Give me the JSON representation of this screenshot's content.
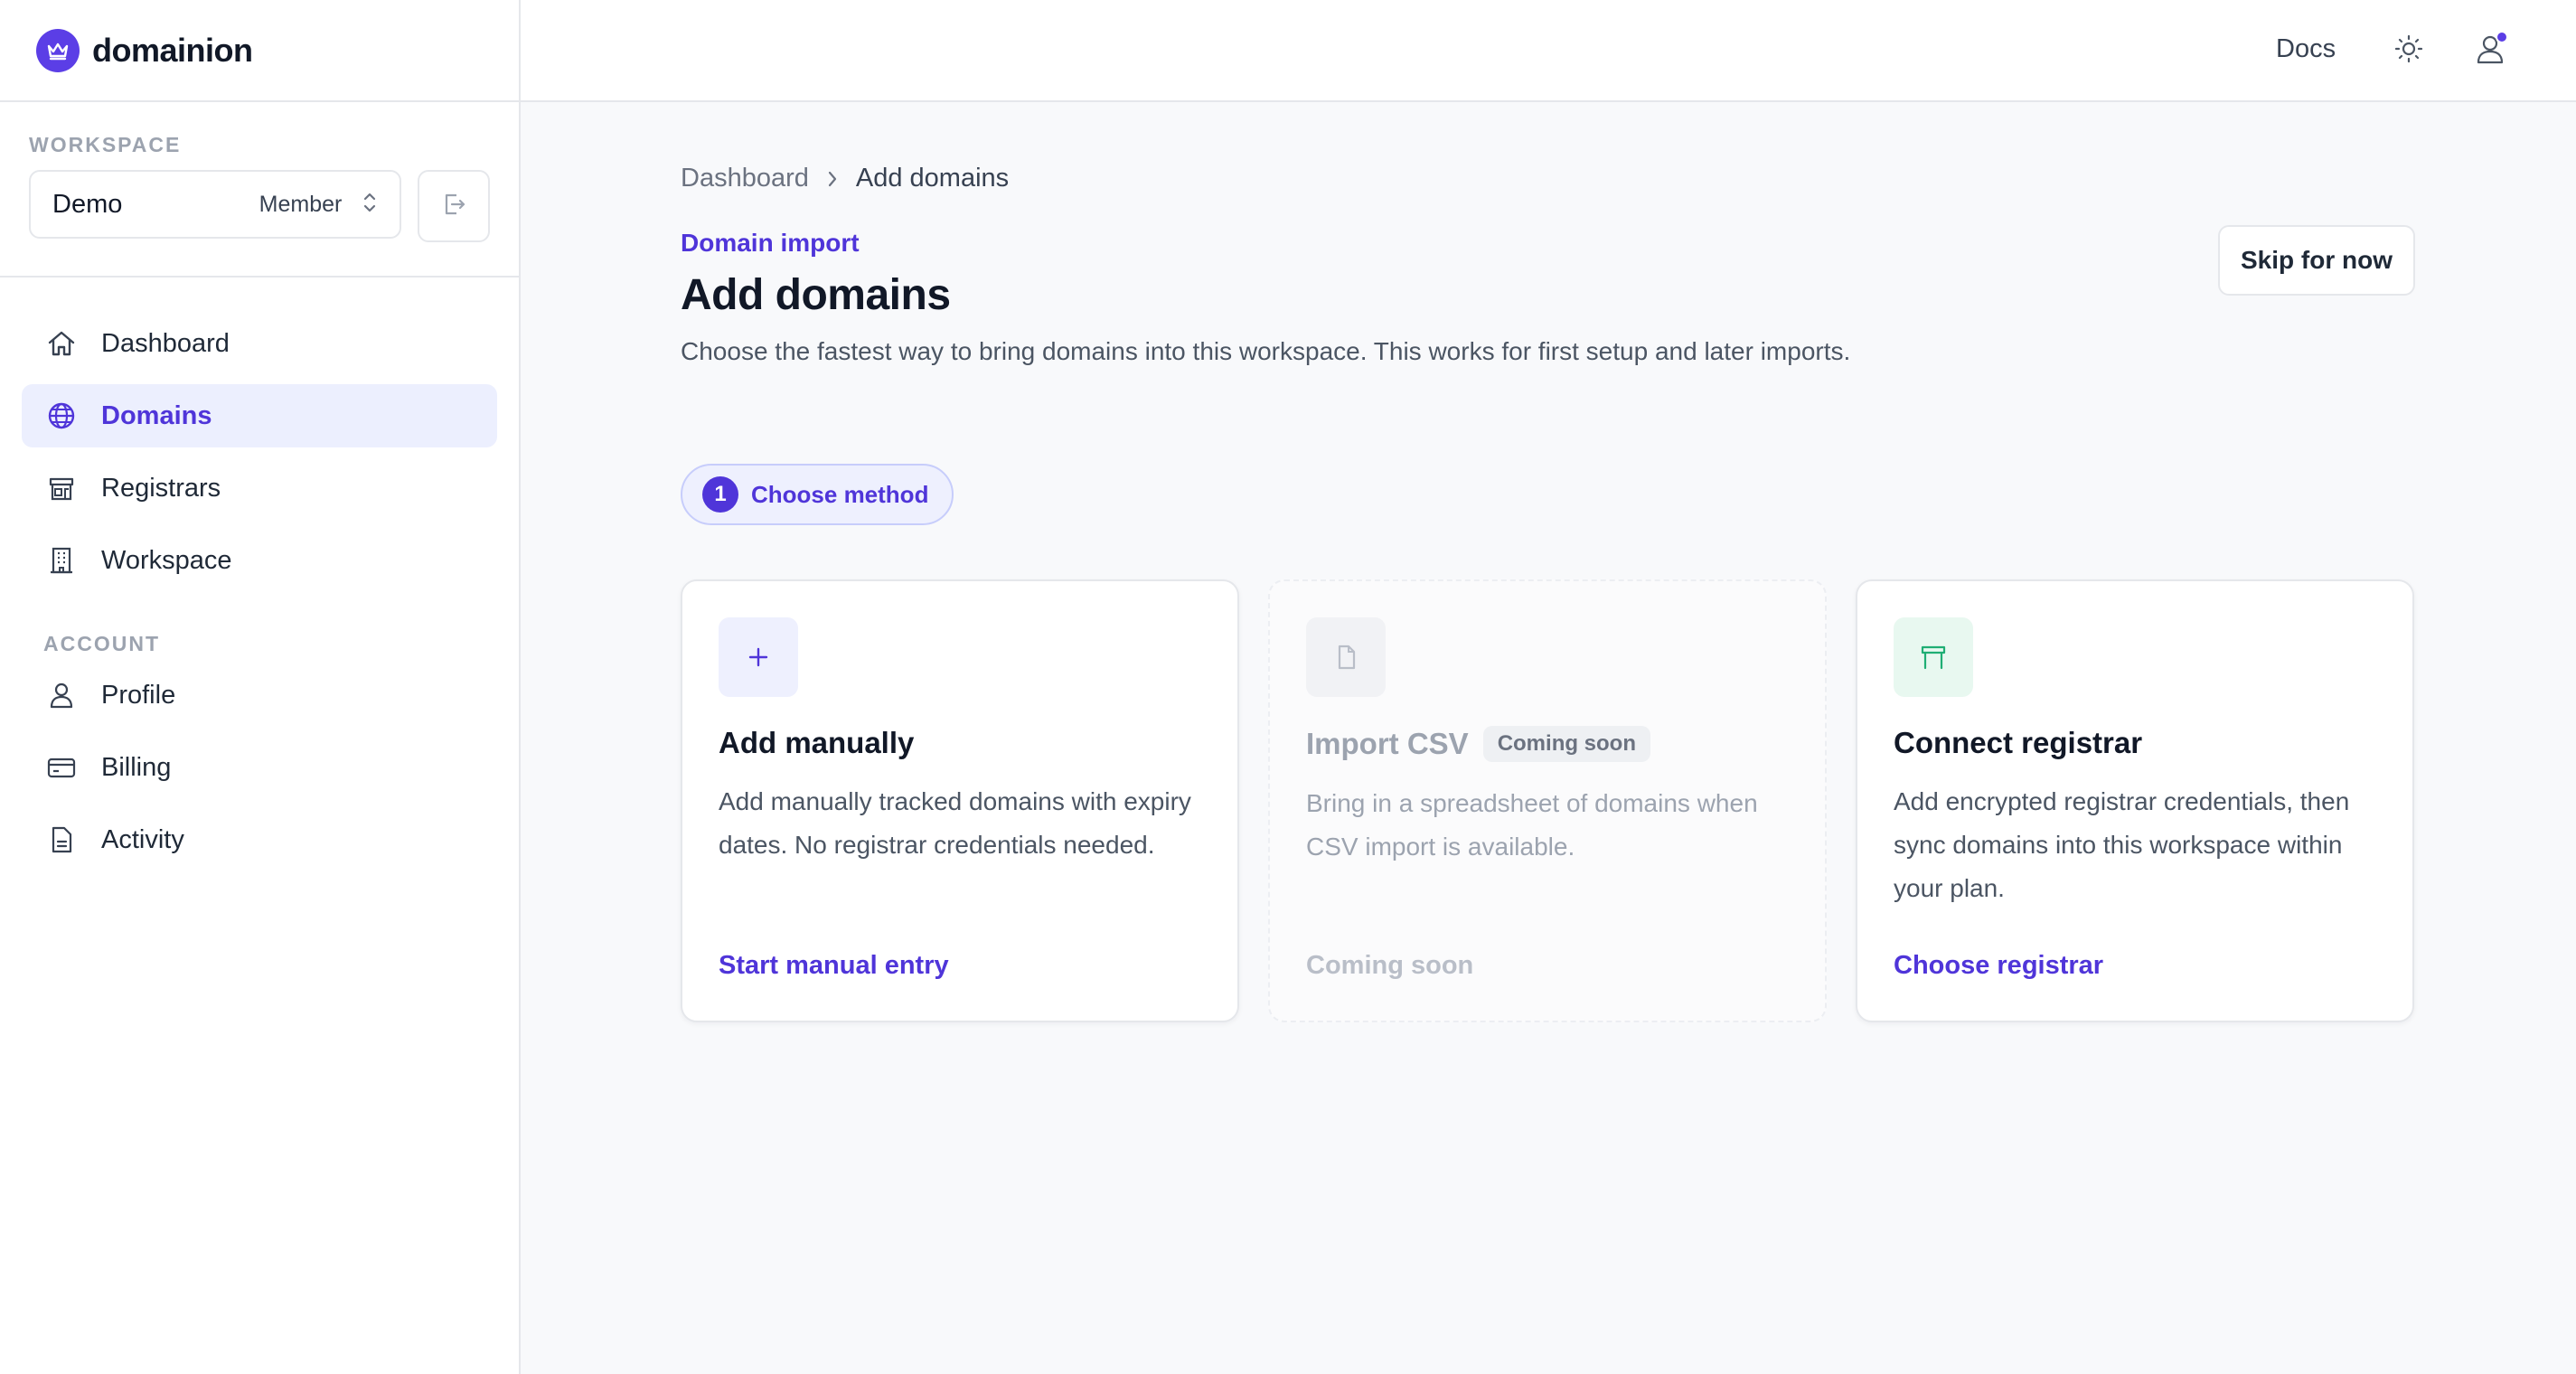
{
  "brand": {
    "name": "domainion",
    "logo_icon": "crown-icon"
  },
  "sidebar": {
    "workspace_label": "WORKSPACE",
    "workspace": {
      "name": "Demo",
      "role": "Member"
    },
    "nav": [
      {
        "label": "Dashboard",
        "icon": "home-icon"
      },
      {
        "label": "Domains",
        "icon": "globe-icon",
        "active": true
      },
      {
        "label": "Registrars",
        "icon": "storefront-icon"
      },
      {
        "label": "Workspace",
        "icon": "building-icon"
      }
    ],
    "account_label": "ACCOUNT",
    "account_nav": [
      {
        "label": "Profile",
        "icon": "user-icon"
      },
      {
        "label": "Billing",
        "icon": "credit-card-icon"
      },
      {
        "label": "Activity",
        "icon": "document-icon"
      }
    ]
  },
  "topbar": {
    "docs_label": "Docs"
  },
  "breadcrumb": {
    "root": "Dashboard",
    "current": "Add domains"
  },
  "page": {
    "eyebrow": "Domain import",
    "title": "Add domains",
    "description": "Choose the fastest way to bring domains into this workspace. This works for first setup and later imports.",
    "skip_label": "Skip for now"
  },
  "step": {
    "number": "1",
    "label": "Choose method"
  },
  "cards": [
    {
      "title": "Add manually",
      "description": "Add manually tracked domains with expiry dates. No registrar credentials needed.",
      "action": "Start manual entry",
      "icon": "plus-icon"
    },
    {
      "title": "Import CSV",
      "badge": "Coming soon",
      "description": "Bring in a spreadsheet of domains when CSV import is available.",
      "action": "Coming soon",
      "icon": "file-icon"
    },
    {
      "title": "Connect registrar",
      "description": "Add encrypted registrar credentials, then sync domains into this workspace within your plan.",
      "action": "Choose registrar",
      "icon": "registrar-icon"
    }
  ],
  "colors": {
    "accent": "#4f35d9",
    "active_nav_bg": "#eceffe",
    "registrar_icon": "#1fae74"
  }
}
